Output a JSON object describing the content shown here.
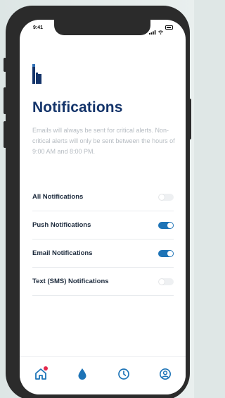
{
  "status_bar": {
    "time": "9:41"
  },
  "page": {
    "title": "Notifications",
    "description": "Emails will always be sent for critical alerts. Non-critical alerts will only be sent between the hours of 9:00 AM and 8:00 PM."
  },
  "settings": [
    {
      "label": "All Notifications",
      "enabled": false
    },
    {
      "label": "Push Notifications",
      "enabled": true
    },
    {
      "label": "Email Notifications",
      "enabled": true
    },
    {
      "label": "Text (SMS) Notifications",
      "enabled": false
    }
  ],
  "tab_bar": {
    "tabs": [
      {
        "icon": "home-icon",
        "active": true,
        "badge": true
      },
      {
        "icon": "water-drop-icon",
        "active": false,
        "badge": false
      },
      {
        "icon": "clock-icon",
        "active": false,
        "badge": false
      },
      {
        "icon": "profile-icon",
        "active": false,
        "badge": false
      }
    ]
  },
  "colors": {
    "brand_navy": "#14346a",
    "accent_blue": "#1e74b7",
    "badge_red": "#e4284c",
    "muted_text": "#b6bcc2"
  }
}
